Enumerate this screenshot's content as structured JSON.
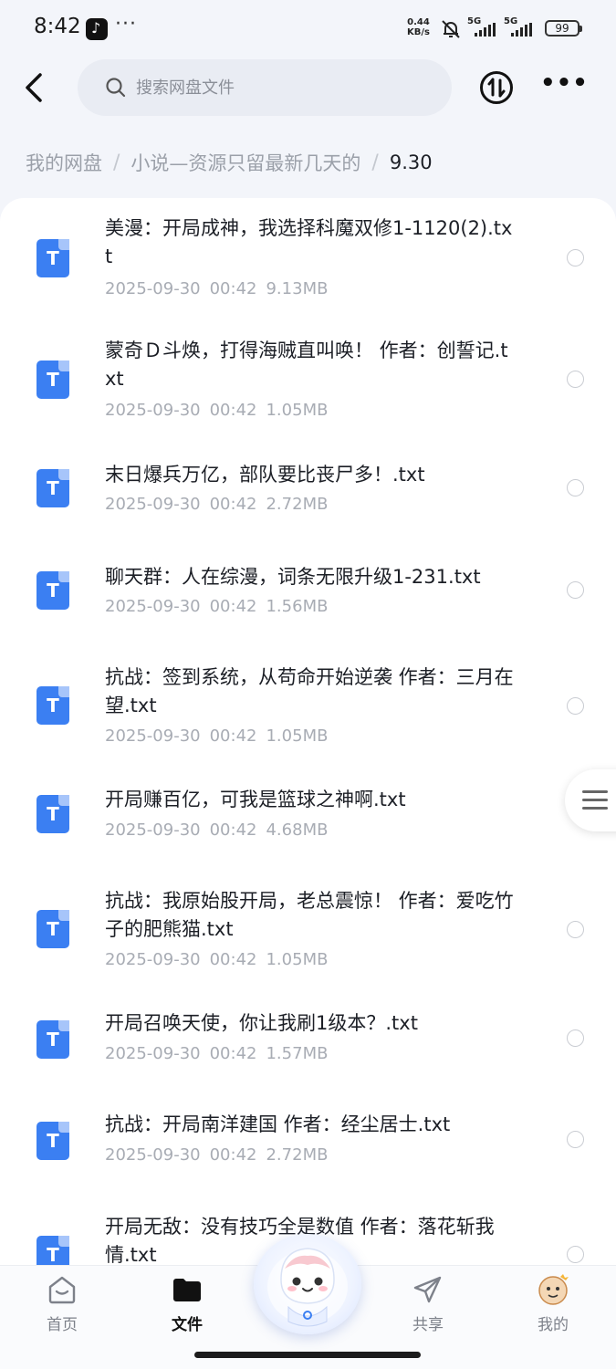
{
  "status_bar": {
    "time": "8:42",
    "extra": "···",
    "net_speed_value": "0.44",
    "net_speed_unit": "KB/s",
    "sim1": "5G",
    "sim2": "5G",
    "battery": "99"
  },
  "header": {
    "search_placeholder": "搜索网盘文件"
  },
  "breadcrumb": {
    "items": [
      "我的网盘",
      "小说—资源只留最新几天的",
      "9.30"
    ],
    "separator": "/"
  },
  "files": [
    {
      "name": "美漫：开局成神，我选择科魔双修1-1120(2).txt",
      "date": "2025-09-30",
      "time": "00:42",
      "size": "9.13MB",
      "icon_letter": "T"
    },
    {
      "name": "蒙奇Ｄ斗焕，打得海贼直叫唤！ 作者：创誓记.txt",
      "date": "2025-09-30",
      "time": "00:42",
      "size": "1.05MB",
      "icon_letter": "T"
    },
    {
      "name": "末日爆兵万亿，部队要比丧尸多！.txt",
      "date": "2025-09-30",
      "time": "00:42",
      "size": "2.72MB",
      "icon_letter": "T"
    },
    {
      "name": "聊天群：人在综漫，词条无限升级1-231.txt",
      "date": "2025-09-30",
      "time": "00:42",
      "size": "1.56MB",
      "icon_letter": "T"
    },
    {
      "name": "抗战：签到系统，从苟命开始逆袭 作者：三月在望.txt",
      "date": "2025-09-30",
      "time": "00:42",
      "size": "1.05MB",
      "icon_letter": "T"
    },
    {
      "name": "开局赚百亿，可我是篮球之神啊.txt",
      "date": "2025-09-30",
      "time": "00:42",
      "size": "4.68MB",
      "icon_letter": "T"
    },
    {
      "name": "抗战：我原始股开局，老总震惊！ 作者：爱吃竹子的肥熊猫.txt",
      "date": "2025-09-30",
      "time": "00:42",
      "size": "1.05MB",
      "icon_letter": "T"
    },
    {
      "name": "开局召唤天使，你让我刷1级本？.txt",
      "date": "2025-09-30",
      "time": "00:42",
      "size": "1.57MB",
      "icon_letter": "T"
    },
    {
      "name": "抗战：开局南洋建国 作者：经尘居士.txt",
      "date": "2025-09-30",
      "time": "00:42",
      "size": "2.72MB",
      "icon_letter": "T"
    },
    {
      "name": "开局无敌：没有技巧全是数值 作者：落花斩我情.txt",
      "date": "",
      "time": "",
      "size": "",
      "icon_letter": "T"
    }
  ],
  "bottom_nav": [
    {
      "label": "首页",
      "icon": "home-icon",
      "active": false
    },
    {
      "label": "文件",
      "icon": "folder-icon",
      "active": true
    },
    {
      "label": "共享",
      "icon": "send-icon",
      "active": false
    },
    {
      "label": "我的",
      "icon": "avatar-icon",
      "active": false
    }
  ],
  "colors": {
    "accent": "#3b7ff2",
    "background": "#f3f5fa",
    "muted_text": "#a8acb4"
  }
}
